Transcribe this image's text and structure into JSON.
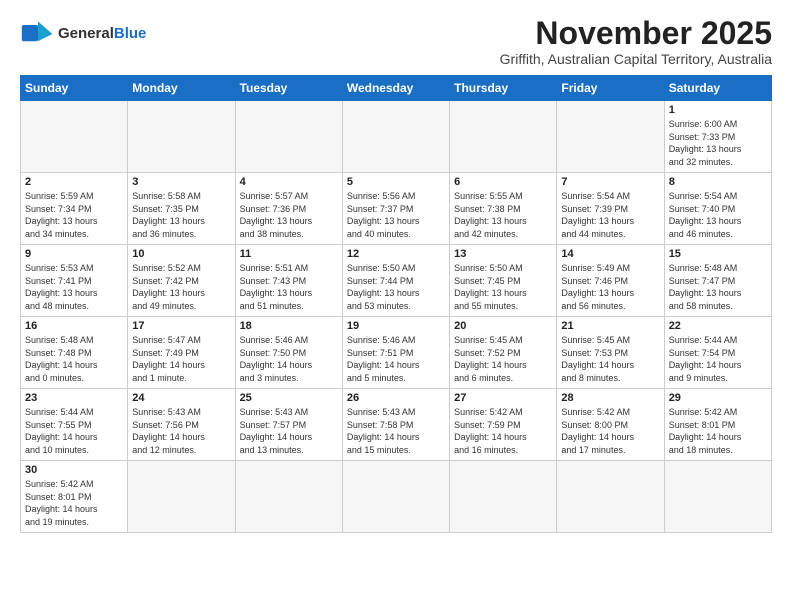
{
  "logo": {
    "general": "General",
    "blue": "Blue"
  },
  "header": {
    "month": "November 2025",
    "location": "Griffith, Australian Capital Territory, Australia"
  },
  "weekdays": [
    "Sunday",
    "Monday",
    "Tuesday",
    "Wednesday",
    "Thursday",
    "Friday",
    "Saturday"
  ],
  "days": [
    {
      "num": "",
      "info": ""
    },
    {
      "num": "",
      "info": ""
    },
    {
      "num": "",
      "info": ""
    },
    {
      "num": "",
      "info": ""
    },
    {
      "num": "",
      "info": ""
    },
    {
      "num": "",
      "info": ""
    },
    {
      "num": "1",
      "info": "Sunrise: 6:00 AM\nSunset: 7:33 PM\nDaylight: 13 hours\nand 32 minutes."
    },
    {
      "num": "2",
      "info": "Sunrise: 5:59 AM\nSunset: 7:34 PM\nDaylight: 13 hours\nand 34 minutes."
    },
    {
      "num": "3",
      "info": "Sunrise: 5:58 AM\nSunset: 7:35 PM\nDaylight: 13 hours\nand 36 minutes."
    },
    {
      "num": "4",
      "info": "Sunrise: 5:57 AM\nSunset: 7:36 PM\nDaylight: 13 hours\nand 38 minutes."
    },
    {
      "num": "5",
      "info": "Sunrise: 5:56 AM\nSunset: 7:37 PM\nDaylight: 13 hours\nand 40 minutes."
    },
    {
      "num": "6",
      "info": "Sunrise: 5:55 AM\nSunset: 7:38 PM\nDaylight: 13 hours\nand 42 minutes."
    },
    {
      "num": "7",
      "info": "Sunrise: 5:54 AM\nSunset: 7:39 PM\nDaylight: 13 hours\nand 44 minutes."
    },
    {
      "num": "8",
      "info": "Sunrise: 5:54 AM\nSunset: 7:40 PM\nDaylight: 13 hours\nand 46 minutes."
    },
    {
      "num": "9",
      "info": "Sunrise: 5:53 AM\nSunset: 7:41 PM\nDaylight: 13 hours\nand 48 minutes."
    },
    {
      "num": "10",
      "info": "Sunrise: 5:52 AM\nSunset: 7:42 PM\nDaylight: 13 hours\nand 49 minutes."
    },
    {
      "num": "11",
      "info": "Sunrise: 5:51 AM\nSunset: 7:43 PM\nDaylight: 13 hours\nand 51 minutes."
    },
    {
      "num": "12",
      "info": "Sunrise: 5:50 AM\nSunset: 7:44 PM\nDaylight: 13 hours\nand 53 minutes."
    },
    {
      "num": "13",
      "info": "Sunrise: 5:50 AM\nSunset: 7:45 PM\nDaylight: 13 hours\nand 55 minutes."
    },
    {
      "num": "14",
      "info": "Sunrise: 5:49 AM\nSunset: 7:46 PM\nDaylight: 13 hours\nand 56 minutes."
    },
    {
      "num": "15",
      "info": "Sunrise: 5:48 AM\nSunset: 7:47 PM\nDaylight: 13 hours\nand 58 minutes."
    },
    {
      "num": "16",
      "info": "Sunrise: 5:48 AM\nSunset: 7:48 PM\nDaylight: 14 hours\nand 0 minutes."
    },
    {
      "num": "17",
      "info": "Sunrise: 5:47 AM\nSunset: 7:49 PM\nDaylight: 14 hours\nand 1 minute."
    },
    {
      "num": "18",
      "info": "Sunrise: 5:46 AM\nSunset: 7:50 PM\nDaylight: 14 hours\nand 3 minutes."
    },
    {
      "num": "19",
      "info": "Sunrise: 5:46 AM\nSunset: 7:51 PM\nDaylight: 14 hours\nand 5 minutes."
    },
    {
      "num": "20",
      "info": "Sunrise: 5:45 AM\nSunset: 7:52 PM\nDaylight: 14 hours\nand 6 minutes."
    },
    {
      "num": "21",
      "info": "Sunrise: 5:45 AM\nSunset: 7:53 PM\nDaylight: 14 hours\nand 8 minutes."
    },
    {
      "num": "22",
      "info": "Sunrise: 5:44 AM\nSunset: 7:54 PM\nDaylight: 14 hours\nand 9 minutes."
    },
    {
      "num": "23",
      "info": "Sunrise: 5:44 AM\nSunset: 7:55 PM\nDaylight: 14 hours\nand 10 minutes."
    },
    {
      "num": "24",
      "info": "Sunrise: 5:43 AM\nSunset: 7:56 PM\nDaylight: 14 hours\nand 12 minutes."
    },
    {
      "num": "25",
      "info": "Sunrise: 5:43 AM\nSunset: 7:57 PM\nDaylight: 14 hours\nand 13 minutes."
    },
    {
      "num": "26",
      "info": "Sunrise: 5:43 AM\nSunset: 7:58 PM\nDaylight: 14 hours\nand 15 minutes."
    },
    {
      "num": "27",
      "info": "Sunrise: 5:42 AM\nSunset: 7:59 PM\nDaylight: 14 hours\nand 16 minutes."
    },
    {
      "num": "28",
      "info": "Sunrise: 5:42 AM\nSunset: 8:00 PM\nDaylight: 14 hours\nand 17 minutes."
    },
    {
      "num": "29",
      "info": "Sunrise: 5:42 AM\nSunset: 8:01 PM\nDaylight: 14 hours\nand 18 minutes."
    },
    {
      "num": "30",
      "info": "Sunrise: 5:42 AM\nSunset: 8:01 PM\nDaylight: 14 hours\nand 19 minutes."
    },
    {
      "num": "",
      "info": ""
    },
    {
      "num": "",
      "info": ""
    },
    {
      "num": "",
      "info": ""
    },
    {
      "num": "",
      "info": ""
    },
    {
      "num": "",
      "info": ""
    }
  ]
}
